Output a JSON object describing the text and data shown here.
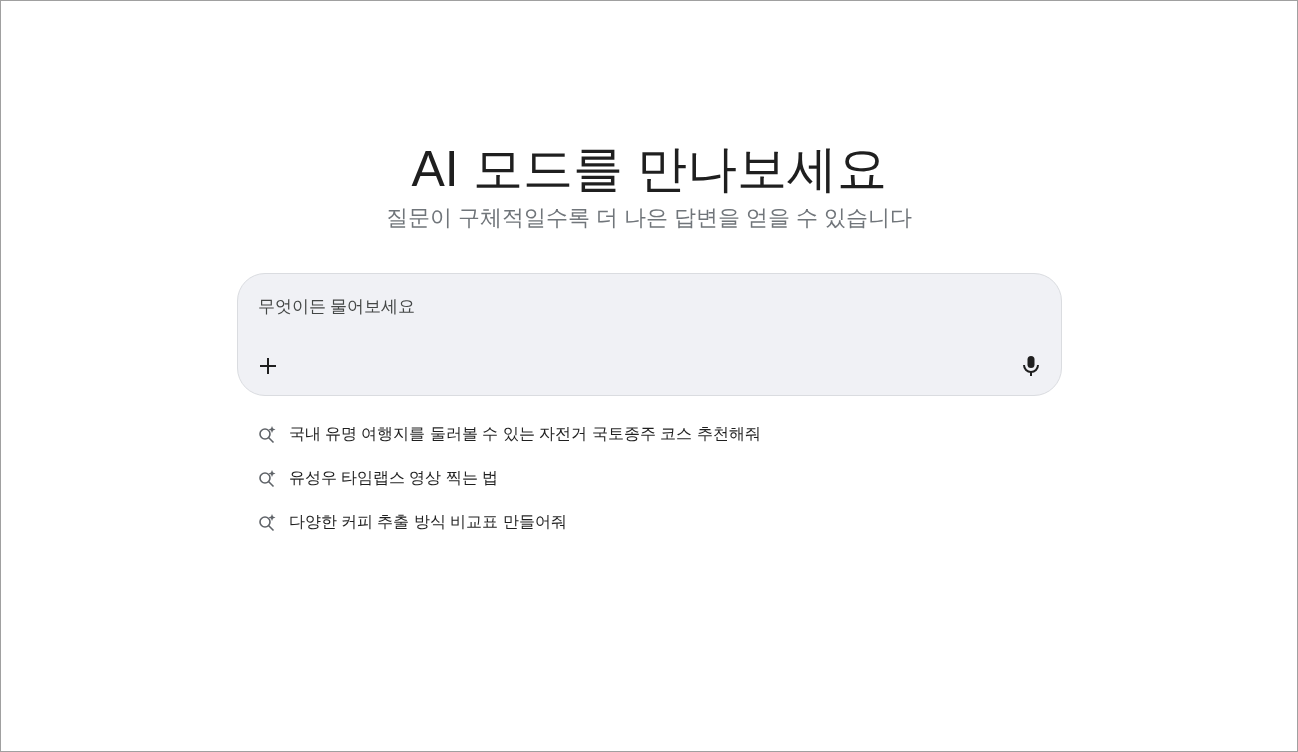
{
  "heading": "AI 모드를 만나보세요",
  "subtitle": "질문이 구체적일수록 더 나은 답변을 얻을 수 있습니다",
  "search": {
    "placeholder": "무엇이든 물어보세요"
  },
  "suggestions": [
    "국내 유명 여행지를 둘러볼 수 있는 자전거 국토종주 코스 추천해줘",
    "유성우 타임랩스 영상 찍는 법",
    "다양한 커피 추출 방식 비교표 만들어줘"
  ]
}
